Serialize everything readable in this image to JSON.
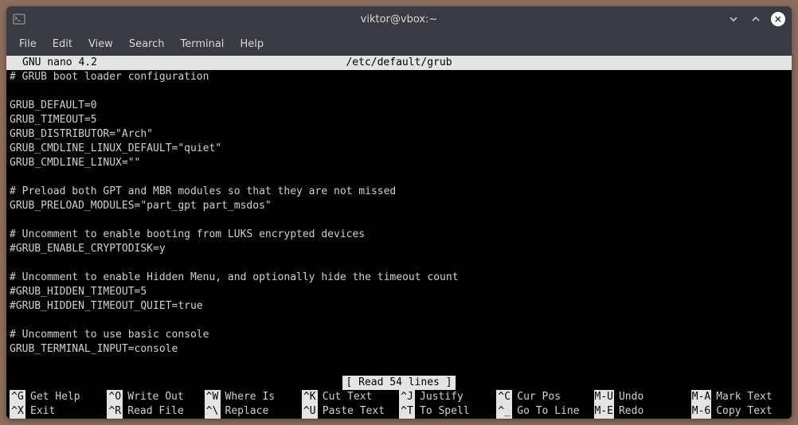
{
  "titlebar": {
    "title": "viktor@vbox:~"
  },
  "menubar": {
    "items": [
      {
        "label": "File"
      },
      {
        "label": "Edit"
      },
      {
        "label": "View"
      },
      {
        "label": "Search"
      },
      {
        "label": "Terminal"
      },
      {
        "label": "Help"
      }
    ]
  },
  "nano": {
    "app": "GNU nano 4.2",
    "filename": "/etc/default/grub",
    "status": "[ Read 54 lines ]",
    "lines": [
      "# GRUB boot loader configuration",
      "",
      "GRUB_DEFAULT=0",
      "GRUB_TIMEOUT=5",
      "GRUB_DISTRIBUTOR=\"Arch\"",
      "GRUB_CMDLINE_LINUX_DEFAULT=\"quiet\"",
      "GRUB_CMDLINE_LINUX=\"\"",
      "",
      "# Preload both GPT and MBR modules so that they are not missed",
      "GRUB_PRELOAD_MODULES=\"part_gpt part_msdos\"",
      "",
      "# Uncomment to enable booting from LUKS encrypted devices",
      "#GRUB_ENABLE_CRYPTODISK=y",
      "",
      "# Uncomment to enable Hidden Menu, and optionally hide the timeout count",
      "#GRUB_HIDDEN_TIMEOUT=5",
      "#GRUB_HIDDEN_TIMEOUT_QUIET=true",
      "",
      "# Uncomment to use basic console",
      "GRUB_TERMINAL_INPUT=console"
    ],
    "shortcuts": [
      {
        "key": "^G",
        "label": "Get Help"
      },
      {
        "key": "^O",
        "label": "Write Out"
      },
      {
        "key": "^W",
        "label": "Where Is"
      },
      {
        "key": "^K",
        "label": "Cut Text"
      },
      {
        "key": "^J",
        "label": "Justify"
      },
      {
        "key": "^C",
        "label": "Cur Pos"
      },
      {
        "key": "M-U",
        "label": "Undo"
      },
      {
        "key": "M-A",
        "label": "Mark Text"
      },
      {
        "key": "^X",
        "label": "Exit"
      },
      {
        "key": "^R",
        "label": "Read File"
      },
      {
        "key": "^\\",
        "label": "Replace"
      },
      {
        "key": "^U",
        "label": "Paste Text"
      },
      {
        "key": "^T",
        "label": "To Spell"
      },
      {
        "key": "^_",
        "label": "Go To Line"
      },
      {
        "key": "M-E",
        "label": "Redo"
      },
      {
        "key": "M-6",
        "label": "Copy Text"
      }
    ]
  }
}
